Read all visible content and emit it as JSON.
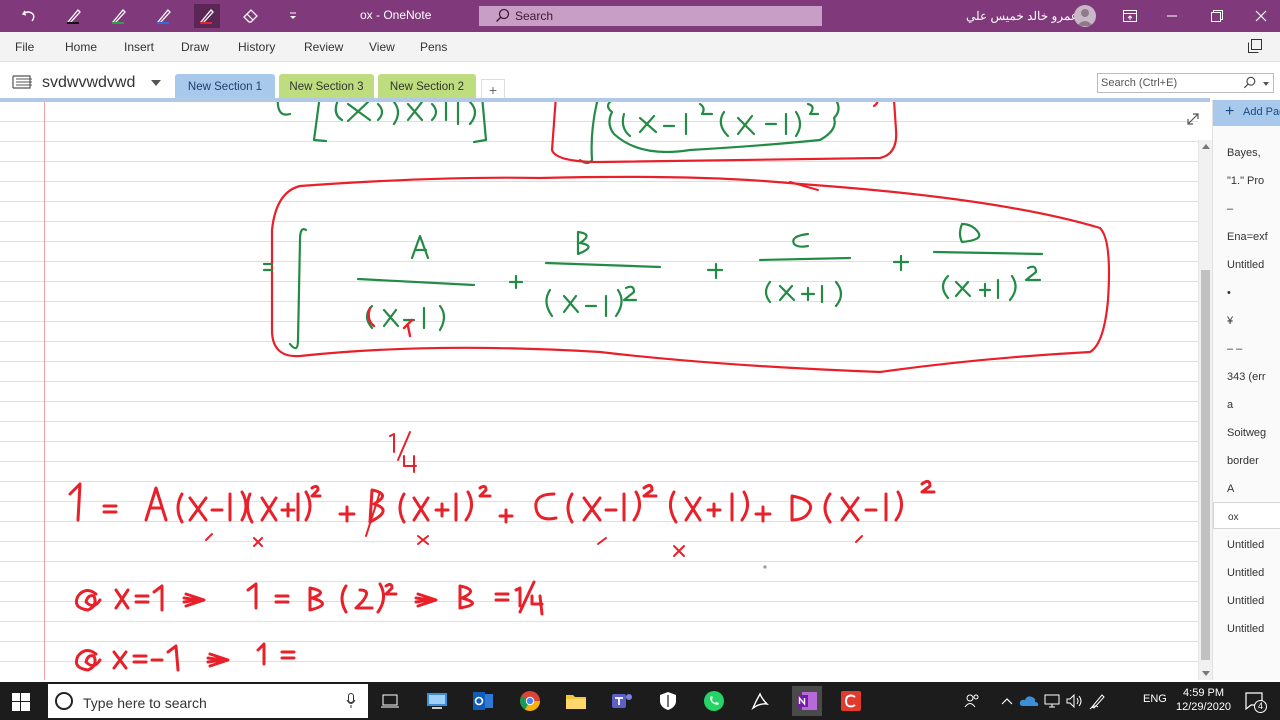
{
  "titlebar": {
    "title": "ox  -  OneNote",
    "search_placeholder": "Search",
    "user_name": "عمرو خالد خميس علي"
  },
  "ribbon": {
    "tabs": [
      "File",
      "Home",
      "Insert",
      "Draw",
      "History",
      "Review",
      "View",
      "Pens"
    ]
  },
  "notebook": {
    "name": "svdwvwdvwd",
    "sections": [
      {
        "label": "New Section 1",
        "color": "#a8c9ec",
        "active": true
      },
      {
        "label": "New Section 3",
        "color": "#bedd7e",
        "active": false
      },
      {
        "label": "New Section 2",
        "color": "#bedd7e",
        "active": false
      }
    ],
    "add_section": "+",
    "search_placeholder": "Search (Ctrl+E)"
  },
  "pages": {
    "add_label": "Add Page",
    "items": [
      "Bayes,",
      "\"1.\" Pro",
      "–",
      "Ena=exf",
      "Untitled",
      "•",
      "¥",
      "– –",
      "343 (err",
      "a",
      "Soitweg",
      "border",
      "A",
      "ox",
      "Untitled",
      "Untitled",
      "Untitled",
      "Untitled"
    ],
    "selected_index": 13
  },
  "ink": {
    "colors": {
      "red": "#e8202a",
      "green": "#238b45"
    },
    "numerators": [
      "A",
      "B",
      "C",
      "D"
    ],
    "plus": "+",
    "equals": "=",
    "annotation": "1/4",
    "line1_lhs": "1",
    "line2_eq": "@x=1  ⇒  1 = B(2)²  ⇒  B = 1/4",
    "line3_eq": "@x=-1  ⇒  1 ="
  },
  "taskbar": {
    "search_text": "Type here to search",
    "lang": "ENG",
    "time": "4:59 PM",
    "date": "12/29/2020",
    "notification_count": "4"
  }
}
